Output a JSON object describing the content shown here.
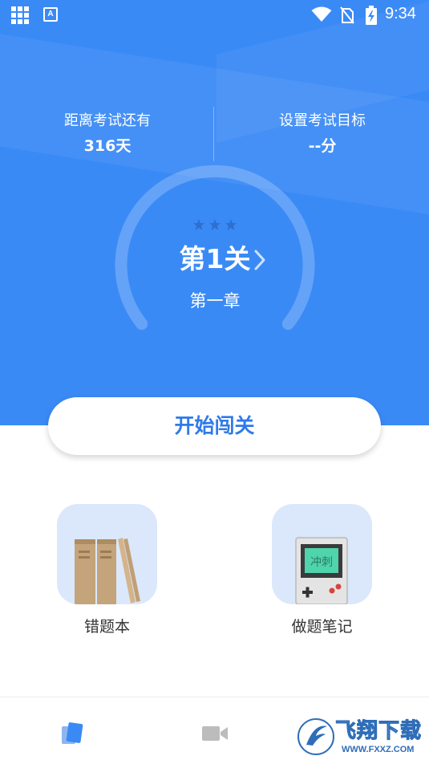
{
  "status_bar": {
    "time": "9:34",
    "keyboard_indicator": "A",
    "icons": [
      "grid-icon",
      "keyboard-icon",
      "wifi-icon",
      "no-sim-icon",
      "battery-charging-icon"
    ]
  },
  "header": {
    "countdown_label": "距离考试还有",
    "countdown_value": "316天",
    "target_label": "设置考试目标",
    "target_value": "--分"
  },
  "level": {
    "stars": 3,
    "title": "第1关",
    "chapter": "第一章"
  },
  "start_button": {
    "label": "开始闯关"
  },
  "features": [
    {
      "label": "错题本",
      "icon": "books-icon"
    },
    {
      "label": "做题笔记",
      "icon": "game-console-icon",
      "screen_text": "冲刺"
    }
  ],
  "bottom_nav": [
    {
      "icon": "book-icon",
      "active": true
    },
    {
      "icon": "video-camera-icon",
      "active": false
    }
  ],
  "watermark": {
    "title": "飞翔下载",
    "url": "WWW.FXXZ.COM"
  },
  "colors": {
    "primary": "#3a8af6",
    "accent_text": "#2f7ae8",
    "tile_bg": "#dbe8fb",
    "label_text": "#333333",
    "nav_inactive": "#bcbcbc",
    "nav_active": "#3a8af6"
  }
}
